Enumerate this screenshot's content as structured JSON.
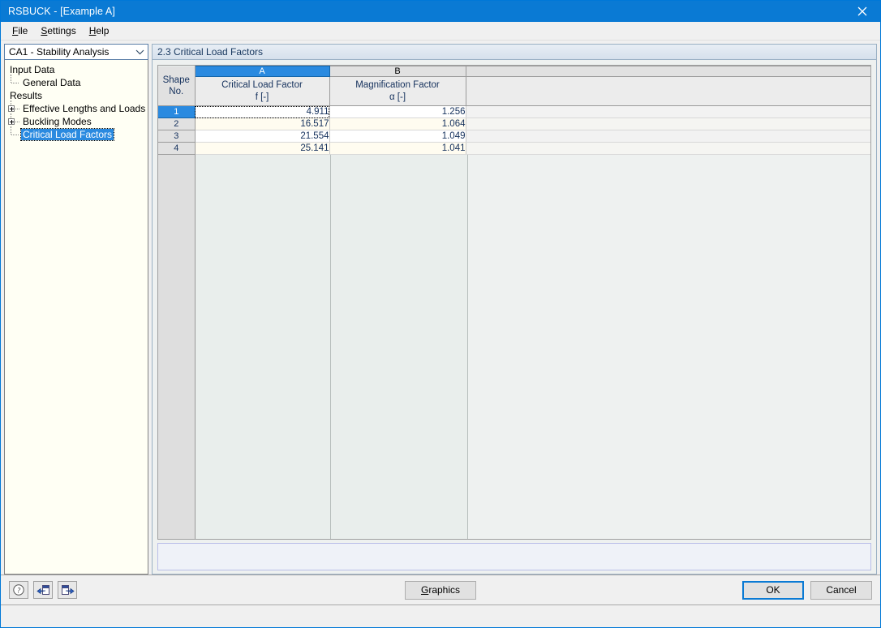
{
  "window": {
    "title": "RSBUCK - [Example A]",
    "close_icon": "close-icon"
  },
  "menubar": {
    "items": [
      {
        "label": "File",
        "accel": "F"
      },
      {
        "label": "Settings",
        "accel": "S"
      },
      {
        "label": "Help",
        "accel": "H"
      }
    ]
  },
  "sidebar": {
    "combo": {
      "value": "CA1 - Stability Analysis",
      "arrow_icon": "chevron-down-icon"
    },
    "tree": [
      {
        "label": "Input Data",
        "level": 0,
        "type": "root",
        "selected": false
      },
      {
        "label": "General Data",
        "level": 1,
        "type": "leaf",
        "selected": false
      },
      {
        "label": "Results",
        "level": 0,
        "type": "root",
        "selected": false
      },
      {
        "label": "Effective Lengths and Loads",
        "level": 1,
        "type": "expandable",
        "selected": false
      },
      {
        "label": "Buckling Modes",
        "level": 1,
        "type": "expandable",
        "selected": false
      },
      {
        "label": "Critical Load Factors",
        "level": 1,
        "type": "leaf",
        "selected": true
      }
    ]
  },
  "main": {
    "panel_title": "2.3 Critical Load Factors",
    "table": {
      "corner_label_line1": "Shape",
      "corner_label_line2": "No.",
      "columns": [
        {
          "letter": "A",
          "selected": true,
          "title": "Critical Load Factor",
          "symbol": "f [-]"
        },
        {
          "letter": "B",
          "selected": false,
          "title": "Magnification Factor",
          "symbol": "α [-]"
        }
      ],
      "rows": [
        {
          "no": "1",
          "selected": true,
          "focused": true,
          "values": [
            "4.911",
            "1.256"
          ]
        },
        {
          "no": "2",
          "selected": false,
          "focused": false,
          "values": [
            "16.517",
            "1.064"
          ]
        },
        {
          "no": "3",
          "selected": false,
          "focused": false,
          "values": [
            "21.554",
            "1.049"
          ]
        },
        {
          "no": "4",
          "selected": false,
          "focused": false,
          "values": [
            "25.141",
            "1.041"
          ]
        }
      ]
    }
  },
  "footer": {
    "tools": [
      {
        "name": "help-icon",
        "title": "Help"
      },
      {
        "name": "previous-icon",
        "title": "Previous"
      },
      {
        "name": "next-icon",
        "title": "Next"
      }
    ],
    "graphics_label": "Graphics",
    "graphics_accel": "G",
    "ok_label": "OK",
    "cancel_label": "Cancel"
  },
  "colors": {
    "title_bar": "#0a7ad4",
    "selection": "#2a8ae0",
    "grid_text": "#14305c",
    "tree_background": "#fffff4",
    "alt_row": "#fffcf0"
  }
}
